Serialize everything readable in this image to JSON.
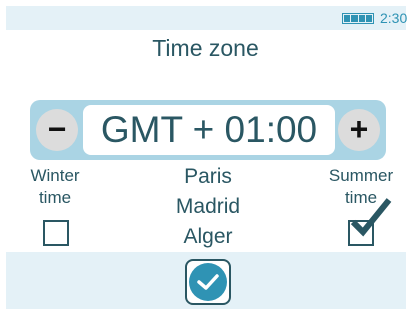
{
  "status": {
    "time": "2:30",
    "battery_level": 1.0,
    "battery_icon": "battery-full-icon"
  },
  "screen": {
    "title": "Time zone"
  },
  "timezone": {
    "value": "GMT + 01:00",
    "decrement_label": "−",
    "increment_label": "+"
  },
  "winter": {
    "label_line1": "Winter",
    "label_line2": "time",
    "checked": false
  },
  "summer": {
    "label_line1": "Summer",
    "label_line2": "time",
    "checked": true
  },
  "cities": [
    "Paris",
    "Madrid",
    "Alger"
  ],
  "confirm": {
    "icon": "checkmark-icon"
  },
  "colors": {
    "accent": "#2f93b4",
    "text": "#2a5763",
    "panel": "#e4f1f7",
    "frame": "#aad4e4"
  }
}
